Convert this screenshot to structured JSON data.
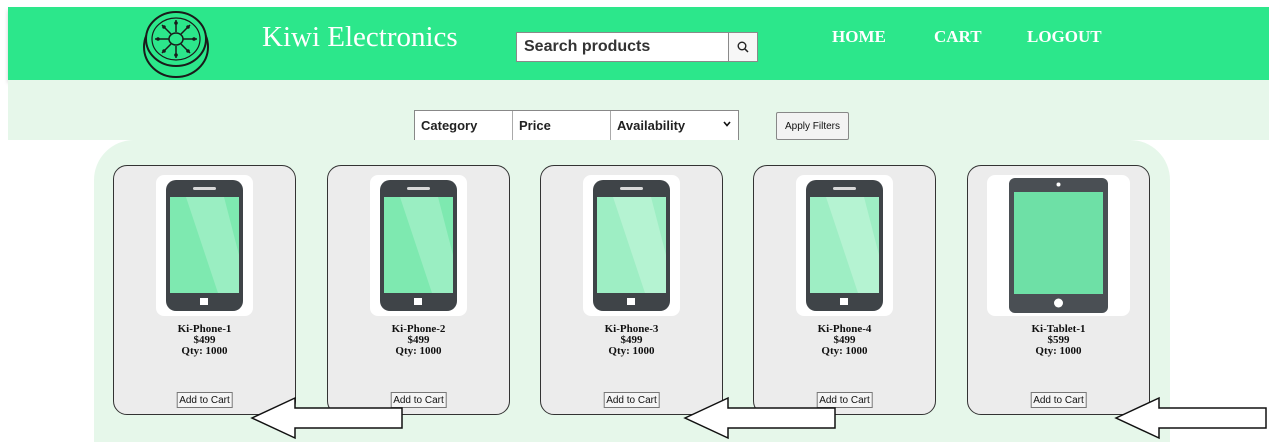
{
  "header": {
    "brand": "Kiwi Electronics",
    "logo_icon": "kiwi-logo-icon",
    "search_placeholder": "Search products",
    "search_icon": "search-icon",
    "nav": [
      {
        "label": "HOME"
      },
      {
        "label": "CART"
      },
      {
        "label": "LOGOUT"
      }
    ],
    "bg_color": "#2ce78b"
  },
  "filters": {
    "category": "Category",
    "price": "Price",
    "availability": "Availability",
    "apply_label": "Apply Filters"
  },
  "products": [
    {
      "name": "Ki-Phone-1",
      "price": "$499",
      "qty": "Qty: 1000",
      "button": "Add to Cart",
      "icon": "phone-icon"
    },
    {
      "name": "Ki-Phone-2",
      "price": "$499",
      "qty": "Qty: 1000",
      "button": "Add to Cart",
      "icon": "phone-icon"
    },
    {
      "name": "Ki-Phone-3",
      "price": "$499",
      "qty": "Qty: 1000",
      "button": "Add to Cart",
      "icon": "phone-icon"
    },
    {
      "name": "Ki-Phone-4",
      "price": "$499",
      "qty": "Qty: 1000",
      "button": "Add to Cart",
      "icon": "phone-icon"
    },
    {
      "name": "Ki-Tablet-1",
      "price": "$599",
      "qty": "Qty: 1000",
      "button": "Add to Cart",
      "icon": "tablet-icon"
    }
  ],
  "colors": {
    "screen_green": "#7ee9b0",
    "device_dark": "#3f4448",
    "page_tint": "#e6f7ea"
  }
}
